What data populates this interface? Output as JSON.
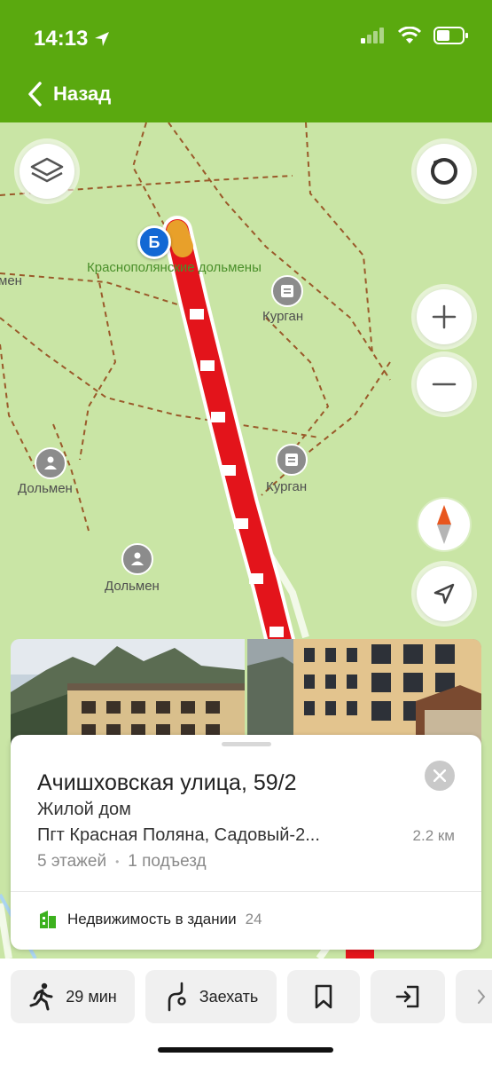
{
  "status": {
    "time": "14:13"
  },
  "nav": {
    "back_label": "Назад"
  },
  "map": {
    "marker_label": "Б",
    "start_place": "Краснополянские дольмены",
    "labels": {
      "kurgan_1": "Курган",
      "kurgan_2": "Курган",
      "dolmen_1": "Дольмен",
      "dolmen_2": "Дольмен",
      "edge_men": "мен"
    }
  },
  "card": {
    "title": "Ачишховская улица, 59/2",
    "subtitle": "Жилой дом",
    "address": "Пгт Красная Поляна, Садовый-2...",
    "distance": "2.2 км",
    "floors": "5 этажей",
    "separator": "•",
    "entrances": "1 подъезд",
    "realty_label": "Недвижимость в здании",
    "realty_count": "24"
  },
  "actions": {
    "walk_time": "29 мин",
    "drive_in": "Заехать"
  },
  "colors": {
    "brand": "#5aa90f",
    "route": "#e3141b",
    "map": "#c9e5a5"
  }
}
